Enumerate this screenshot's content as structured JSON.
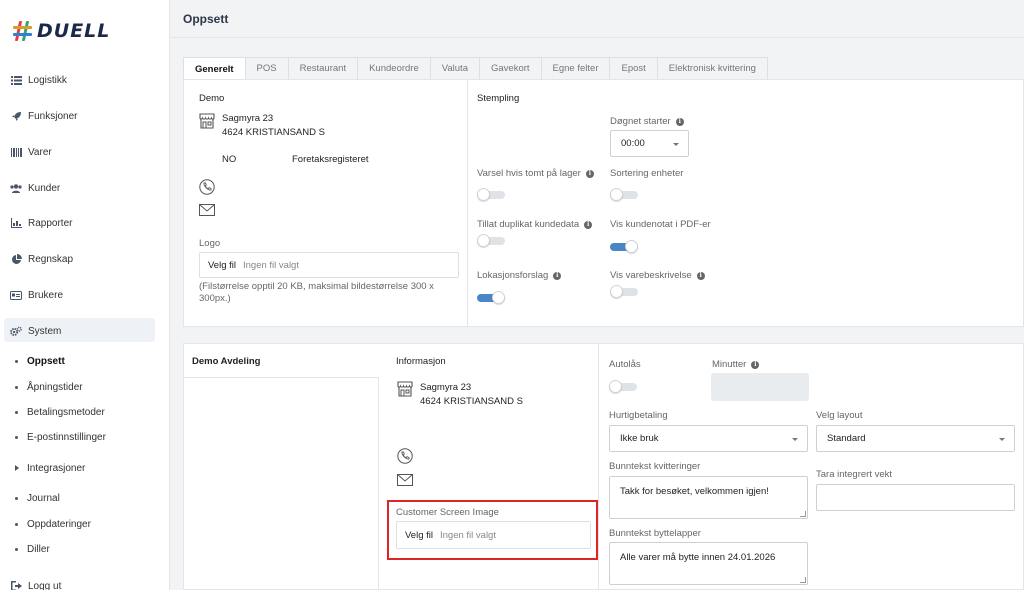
{
  "brand": {
    "name": "DUELL"
  },
  "nav": {
    "items": [
      {
        "label": "Logistikk",
        "icon": "list-icon"
      },
      {
        "label": "Funksjoner",
        "icon": "rocket-icon"
      },
      {
        "label": "Varer",
        "icon": "barcode-icon"
      },
      {
        "label": "Kunder",
        "icon": "users-icon"
      },
      {
        "label": "Rapporter",
        "icon": "chart-icon"
      },
      {
        "label": "Regnskap",
        "icon": "pie-chart-icon"
      },
      {
        "label": "Brukere",
        "icon": "id-card-icon"
      },
      {
        "label": "System",
        "icon": "gears-icon"
      }
    ],
    "system_sub": [
      "Oppsett",
      "Åpningstider",
      "Betalingsmetoder",
      "E-postinnstillinger",
      "Integrasjoner",
      "Journal",
      "Oppdateringer",
      "Diller"
    ],
    "logout": "Logg ut"
  },
  "header": {
    "title": "Oppsett"
  },
  "tabs": [
    "Generelt",
    "POS",
    "Restaurant",
    "Kundeordre",
    "Valuta",
    "Gavekort",
    "Egne felter",
    "Epost",
    "Elektronisk kvittering"
  ],
  "company": {
    "name": "Demo",
    "street": "Sagmyra 23",
    "city": "4624 KRISTIANSAND S",
    "country": "NO",
    "registry": "Foretaksregisteret",
    "logo_label": "Logo",
    "file_button": "Velg fil",
    "no_file": "Ingen fil valgt",
    "logo_hint": "(Filstørrelse opptil 20 KB, maksimal bildestørrelse 300 x 300px.)"
  },
  "stamping": {
    "title": "Stempling",
    "day_start_label": "Døgnet starter",
    "day_start_value": "00:00",
    "fields": [
      {
        "label": "Varsel hvis tomt på lager",
        "on": false
      },
      {
        "label": "Sortering enheter",
        "on": false
      },
      {
        "label": "Tillat duplikat kundedata",
        "on": false
      },
      {
        "label": "Vis kundenotat i PDF-er",
        "on": true
      },
      {
        "label": "Lokasjonsforslag",
        "on": true
      },
      {
        "label": "Vis varebeskrivelse",
        "on": false
      }
    ]
  },
  "department": {
    "name": "Demo Avdeling",
    "info_title": "Informasjon",
    "street": "Sagmyra 23",
    "city": "4624 KRISTIANSAND S",
    "customer_screen_label": "Customer Screen Image",
    "file_button": "Velg fil",
    "no_file": "Ingen fil valgt"
  },
  "settings": {
    "autolock_label": "Autolås",
    "minutes_label": "Minutter",
    "minutes_value": "",
    "quick_pay_label": "Hurtigbetaling",
    "quick_pay_value": "Ikke bruk",
    "layout_label": "Velg layout",
    "layout_value": "Standard",
    "receipt_footer_label": "Bunntekst kvitteringer",
    "receipt_footer_value": "Takk for besøket, velkommen igjen!",
    "tara_label": "Tara integrert vekt",
    "tara_value": "",
    "exchange_footer_label": "Bunntekst byttelapper",
    "exchange_footer_value": "Alle varer må bytte innen 24.01.2026"
  },
  "colors": {
    "accent": "#4a86c5",
    "highlight": "#e02424",
    "navy": "#1b2a4a"
  }
}
